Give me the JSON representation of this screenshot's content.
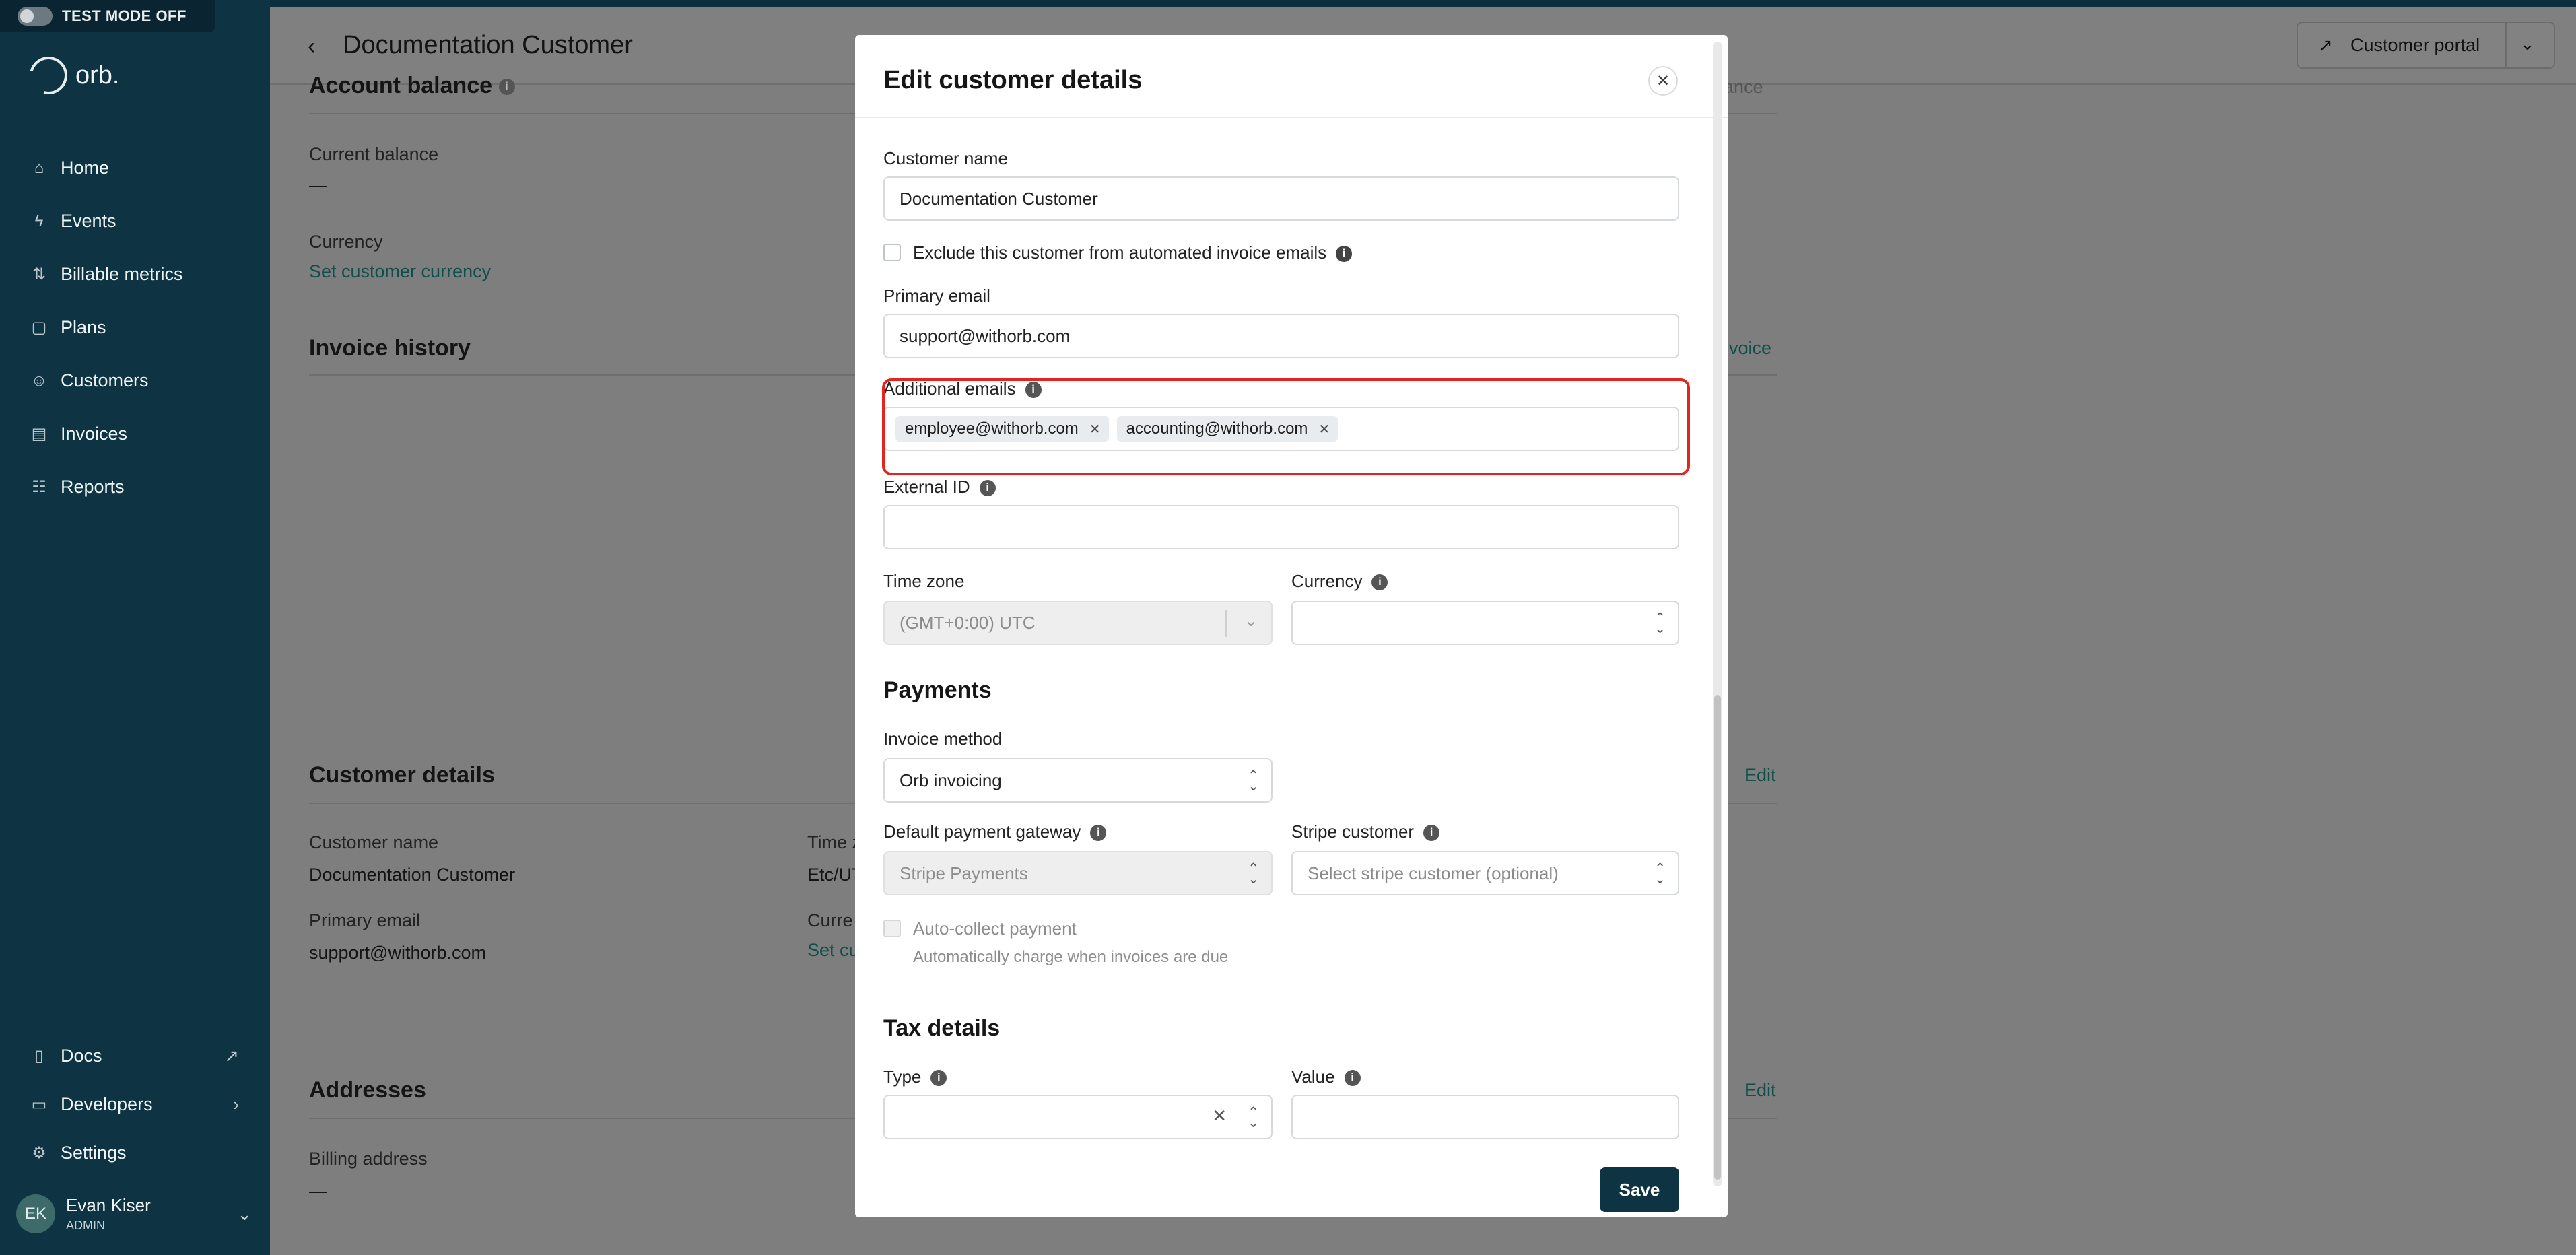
{
  "test_mode": {
    "label": "TEST MODE OFF"
  },
  "brand": {
    "name": "orb."
  },
  "sidebar": {
    "items": [
      {
        "label": "Home",
        "icon": "home-icon"
      },
      {
        "label": "Events",
        "icon": "lightning-icon"
      },
      {
        "label": "Billable metrics",
        "icon": "metrics-icon"
      },
      {
        "label": "Plans",
        "icon": "plans-icon"
      },
      {
        "label": "Customers",
        "icon": "users-icon"
      },
      {
        "label": "Invoices",
        "icon": "invoice-icon"
      },
      {
        "label": "Reports",
        "icon": "table-icon"
      }
    ],
    "bottom": [
      {
        "label": "Docs",
        "icon": "docs-icon"
      },
      {
        "label": "Developers",
        "icon": "folder-icon"
      },
      {
        "label": "Settings",
        "icon": "gear-icon"
      }
    ],
    "user": {
      "initials": "EK",
      "name": "Evan Kiser",
      "role": "ADMIN"
    }
  },
  "header": {
    "title": "Documentation Customer",
    "portal_label": "Customer portal"
  },
  "background": {
    "account_balance": "Account balance",
    "right_hint": "alance",
    "current_balance_label": "Current balance",
    "current_balance_value": "—",
    "currency_label": "Currency",
    "currency_link": "Set customer currency",
    "invoice_history": "Invoice history",
    "invoice_link": "nvoice",
    "customer_details": "Customer details",
    "edit1": "Edit",
    "cust_name_label": "Customer name",
    "cust_name_value": "Documentation Customer",
    "time_label": "Time z",
    "time_value": "Etc/UT",
    "primary_email_label": "Primary email",
    "primary_email_value": "support@withorb.com",
    "curr_label": "Curre",
    "curr_link": "Set cu",
    "addresses": "Addresses",
    "edit2": "Edit",
    "billing_label": "Billing address",
    "billing_value": "—"
  },
  "modal": {
    "title": "Edit customer details",
    "customer_name_label": "Customer name",
    "customer_name_value": "Documentation Customer",
    "exclude_label": "Exclude this customer from automated invoice emails",
    "primary_email_label": "Primary email",
    "primary_email_value": "support@withorb.com",
    "additional_emails_label": "Additional emails",
    "additional_emails": [
      "employee@withorb.com",
      "accounting@withorb.com"
    ],
    "external_id_label": "External ID",
    "external_id_value": "",
    "timezone_label": "Time zone",
    "timezone_value": "(GMT+0:00) UTC",
    "currency_label": "Currency",
    "currency_value": "",
    "payments_heading": "Payments",
    "invoice_method_label": "Invoice method",
    "invoice_method_value": "Orb invoicing",
    "gateway_label": "Default payment gateway",
    "gateway_value": "Stripe Payments",
    "stripe_customer_label": "Stripe customer",
    "stripe_customer_placeholder": "Select stripe customer (optional)",
    "autocollect_label": "Auto-collect payment",
    "autocollect_help": "Automatically charge when invoices are due",
    "tax_heading": "Tax details",
    "tax_type_label": "Type",
    "tax_value_label": "Value",
    "save_label": "Save"
  },
  "colors": {
    "sidebar": "#0e3444",
    "accent": "#0e3444",
    "highlight": "#e0261f",
    "link": "#0f4f4a"
  }
}
